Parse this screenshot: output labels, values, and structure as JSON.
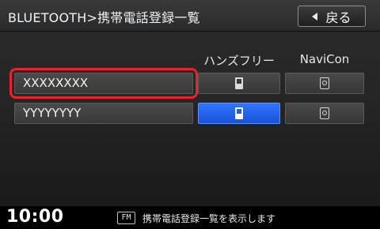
{
  "header": {
    "title": "BLUETOOTH>携帯電話登録一覧",
    "back_label": "戻る"
  },
  "columns": {
    "handsfree": "ハンズフリー",
    "navicon": "NaviCon"
  },
  "devices": [
    {
      "name": "XXXXXXXX",
      "selected": true,
      "handsfree_active": false,
      "navicon_active": false
    },
    {
      "name": "YYYYYYYY",
      "selected": false,
      "handsfree_active": true,
      "navicon_active": false
    }
  ],
  "footer": {
    "clock": "10:00",
    "source_badge": "FM",
    "status": "携帯電話登録一覧を表示します"
  },
  "colors": {
    "accent_active": "#2f76ff",
    "selection_frame": "#e8232c"
  },
  "icons": {
    "back": "left-triangle-icon",
    "handsfree": "phone-icon",
    "navicon": "navicon-icon"
  }
}
